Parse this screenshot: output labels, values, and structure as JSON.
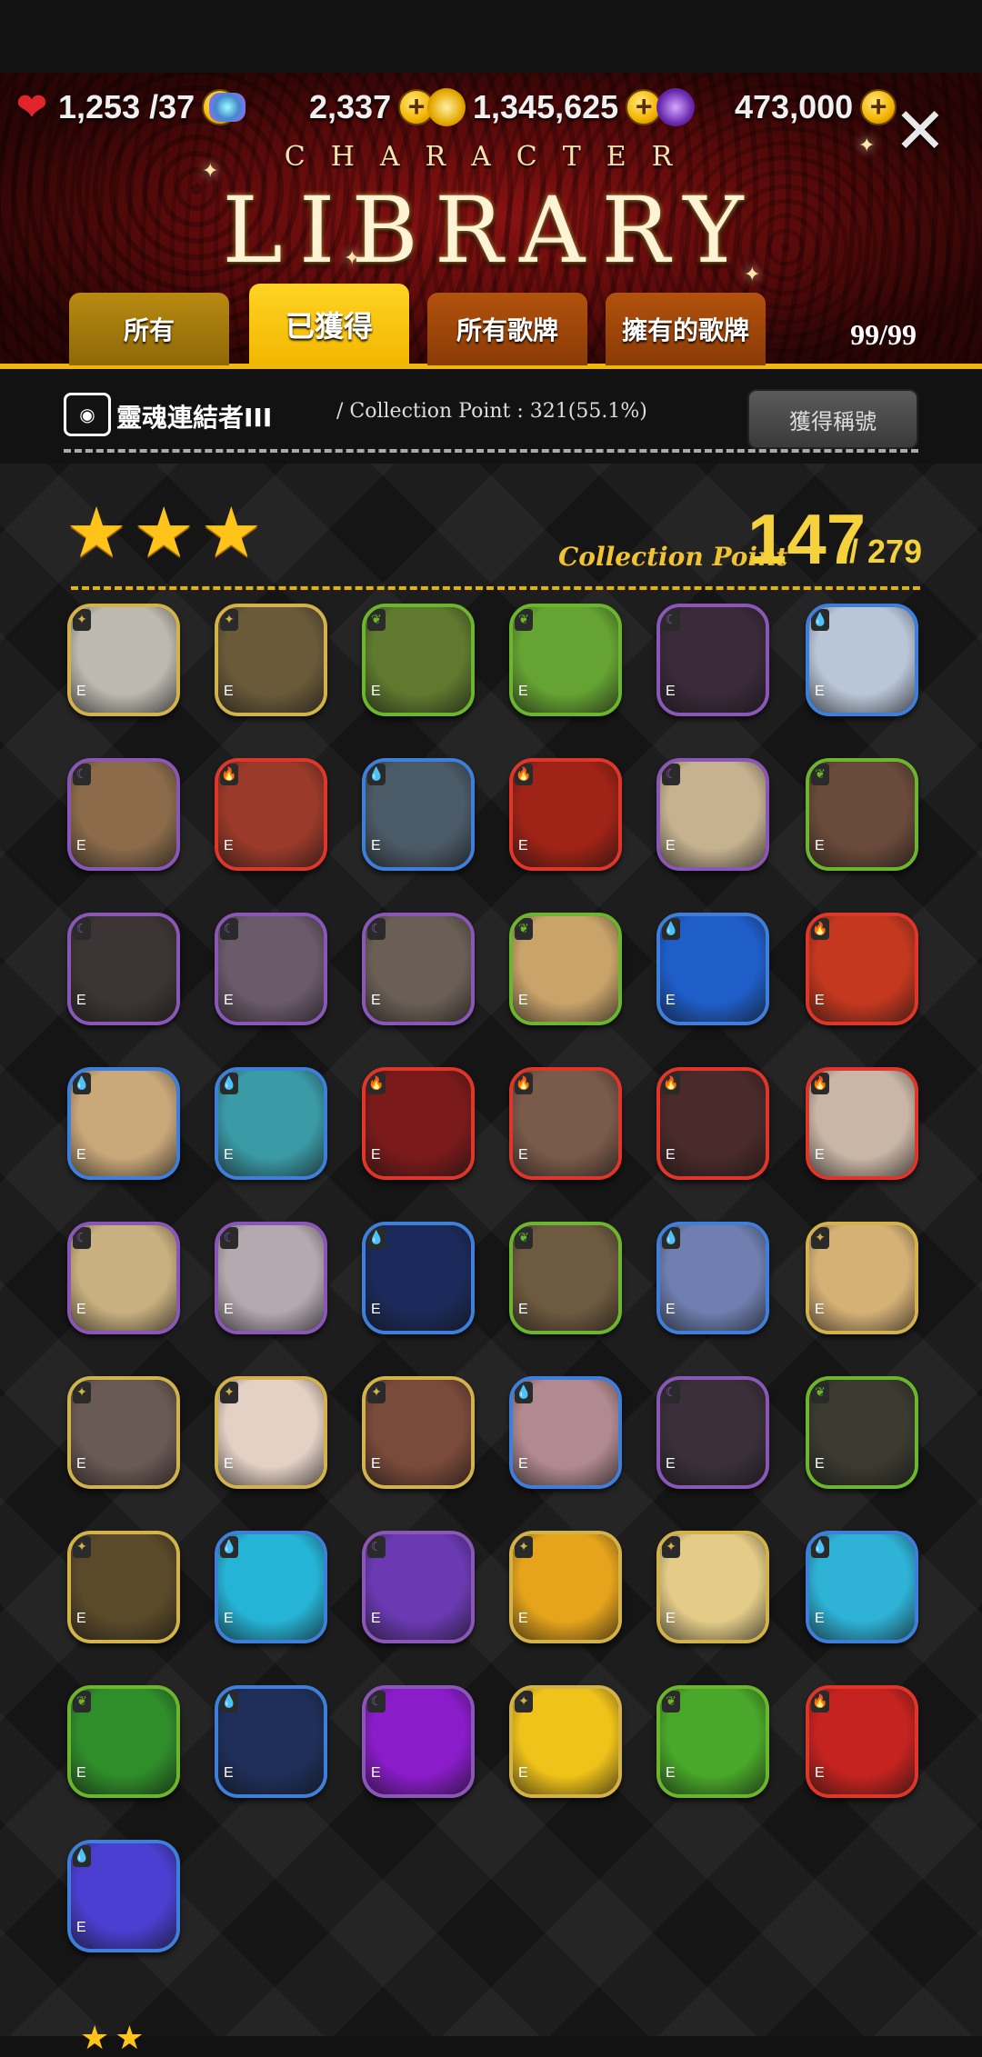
{
  "resources": {
    "stamina": "1,253 /37",
    "gems": "2,337",
    "gold": "1,345,625",
    "crystal": "473,000"
  },
  "title": {
    "small": "CHARACTER",
    "big": "LIBRARY"
  },
  "tabs": [
    "所有",
    "已獲得",
    "所有歌牌",
    "擁有的歌牌"
  ],
  "tab_count": "99/99",
  "title_row": {
    "rank_title": "靈魂連結者III",
    "collection": "/ Collection Point : 321(55.1%)",
    "button": "獲得稱號"
  },
  "section": {
    "stars": 3,
    "label": "Collection Point",
    "value": "147",
    "total": "/ 279"
  },
  "cards": [
    {
      "border": "#d3b24a",
      "bg": "#bdb9b0",
      "elem": "✦"
    },
    {
      "border": "#d3b24a",
      "bg": "#6a5a3a",
      "elem": "✦"
    },
    {
      "border": "#6bb62c",
      "bg": "#5f7a2f",
      "elem": "❦"
    },
    {
      "border": "#6bb62c",
      "bg": "#65a332",
      "elem": "❦"
    },
    {
      "border": "#8a57b8",
      "bg": "#3a2a3a",
      "elem": "☾"
    },
    {
      "border": "#3f7fdc",
      "bg": "#b9c6d8",
      "elem": "💧"
    },
    {
      "border": "#8a57b8",
      "bg": "#8b6b4a",
      "elem": "☾"
    },
    {
      "border": "#e0362a",
      "bg": "#9a3a2a",
      "elem": "🔥"
    },
    {
      "border": "#3f7fdc",
      "bg": "#4b5a67",
      "elem": "💧"
    },
    {
      "border": "#e0362a",
      "bg": "#9f2316",
      "elem": "🔥"
    },
    {
      "border": "#8a57b8",
      "bg": "#c6b28f",
      "elem": "☾"
    },
    {
      "border": "#6bb62c",
      "bg": "#6a4a3a",
      "elem": "❦"
    },
    {
      "border": "#8a57b8",
      "bg": "#3d3535",
      "elem": "☾"
    },
    {
      "border": "#8a57b8",
      "bg": "#6a5a6a",
      "elem": "☾"
    },
    {
      "border": "#8a57b8",
      "bg": "#6a5f55",
      "elem": "☾"
    },
    {
      "border": "#6bb62c",
      "bg": "#c9a36a",
      "elem": "❦"
    },
    {
      "border": "#3f7fdc",
      "bg": "#1f5ec9",
      "elem": "💧"
    },
    {
      "border": "#e0362a",
      "bg": "#c4381f",
      "elem": "🔥"
    },
    {
      "border": "#3f7fdc",
      "bg": "#c9a87a",
      "elem": "💧"
    },
    {
      "border": "#3f7fdc",
      "bg": "#3a9aa6",
      "elem": "💧"
    },
    {
      "border": "#e0362a",
      "bg": "#7b1a1a",
      "elem": "🔥"
    },
    {
      "border": "#e0362a",
      "bg": "#7a5a4a",
      "elem": "🔥"
    },
    {
      "border": "#e0362a",
      "bg": "#4a2a2a",
      "elem": "🔥"
    },
    {
      "border": "#e0362a",
      "bg": "#c9b6a6",
      "elem": "🔥"
    },
    {
      "border": "#8a57b8",
      "bg": "#c9b080",
      "elem": "☾"
    },
    {
      "border": "#8a57b8",
      "bg": "#b5a9b0",
      "elem": "☾"
    },
    {
      "border": "#3f7fdc",
      "bg": "#1b2a5a",
      "elem": "💧"
    },
    {
      "border": "#6bb62c",
      "bg": "#6e5a40",
      "elem": "❦"
    },
    {
      "border": "#3f7fdc",
      "bg": "#6f7fb0",
      "elem": "💧"
    },
    {
      "border": "#d3b24a",
      "bg": "#d6b176",
      "elem": "✦"
    },
    {
      "border": "#d3b24a",
      "bg": "#6a5a55",
      "elem": "✦"
    },
    {
      "border": "#d3b24a",
      "bg": "#e4d0c4",
      "elem": "✦"
    },
    {
      "border": "#d3b24a",
      "bg": "#7a4a3a",
      "elem": "✦"
    },
    {
      "border": "#3f7fdc",
      "bg": "#b18a90",
      "elem": "💧"
    },
    {
      "border": "#8a57b8",
      "bg": "#3a2f3a",
      "elem": "☾"
    },
    {
      "border": "#6bb62c",
      "bg": "#3a3a30",
      "elem": "❦"
    },
    {
      "border": "#d3b24a",
      "bg": "#5a4a2a",
      "elem": "✦"
    },
    {
      "border": "#3f7fdc",
      "bg": "#26b4d6",
      "elem": "💧"
    },
    {
      "border": "#8a57b8",
      "bg": "#6b3ab2",
      "elem": "☾"
    },
    {
      "border": "#d3b24a",
      "bg": "#e6a41c",
      "elem": "✦"
    },
    {
      "border": "#d3b24a",
      "bg": "#e4cc88",
      "elem": "✦"
    },
    {
      "border": "#3f7fdc",
      "bg": "#2eb2d6",
      "elem": "💧"
    },
    {
      "border": "#6bb62c",
      "bg": "#2f8d2a",
      "elem": "❦"
    },
    {
      "border": "#3f7fdc",
      "bg": "#1f2f5a",
      "elem": "💧"
    },
    {
      "border": "#8a57b8",
      "bg": "#8a1cc9",
      "elem": "☾"
    },
    {
      "border": "#d3b24a",
      "bg": "#f0c31a",
      "elem": "✦"
    },
    {
      "border": "#6bb62c",
      "bg": "#49a82a",
      "elem": "❦"
    },
    {
      "border": "#e0362a",
      "bg": "#c4231f",
      "elem": "🔥"
    },
    {
      "border": "#3f7fdc",
      "bg": "#4a3fd0",
      "elem": "💧"
    }
  ],
  "rank_letter": "E"
}
